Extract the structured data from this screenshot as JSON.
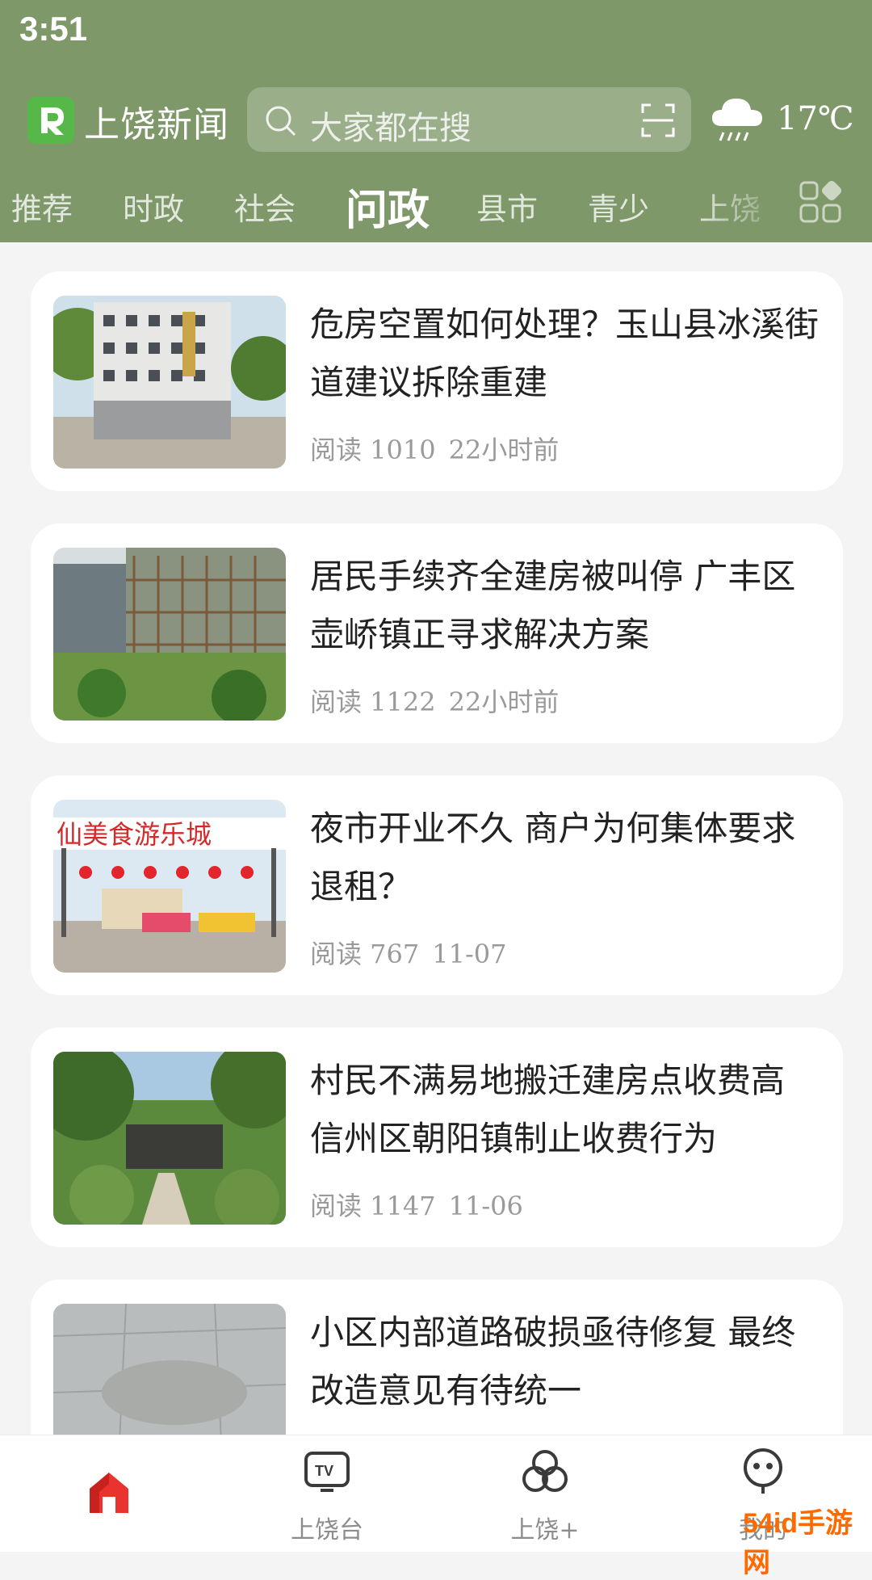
{
  "status_bar": {
    "time": "3:51"
  },
  "header": {
    "app_name": "上饶新闻",
    "search_placeholder": "大家都在搜",
    "weather_temp": "17℃",
    "tabs": [
      "推荐",
      "时政",
      "社会",
      "问政",
      "县市",
      "青少",
      "上饶"
    ],
    "active_tab": "问政"
  },
  "feed": [
    {
      "title": "危房空置如何处理？玉山县冰溪街道建议拆除重建",
      "reads": "阅读 1010",
      "time": "22小时前"
    },
    {
      "title": "居民手续齐全建房被叫停 广丰区壶峤镇正寻求解决方案",
      "reads": "阅读 1122",
      "time": "22小时前"
    },
    {
      "title": "夜市开业不久 商户为何集体要求退租？",
      "reads": "阅读 767",
      "time": "11-07",
      "image_sign_text": "仙美食游乐城"
    },
    {
      "title": "村民不满易地搬迁建房点收费高 信州区朝阳镇制止收费行为",
      "reads": "阅读 1147",
      "time": "11-06"
    },
    {
      "title": "小区内部道路破损亟待修复 最终改造意见有待统一"
    }
  ],
  "bottom_nav": [
    {
      "label": "",
      "icon": "home-icon",
      "active": true
    },
    {
      "label": "上饶台",
      "icon": "tv-icon"
    },
    {
      "label": "上饶+",
      "icon": "circles-icon"
    },
    {
      "label": "我的",
      "icon": "robot-icon"
    }
  ],
  "watermark": "54id手游网",
  "colors": {
    "header_bg": "#7f986a",
    "accent_red": "#e8332e",
    "card_bg": "#ffffff"
  }
}
